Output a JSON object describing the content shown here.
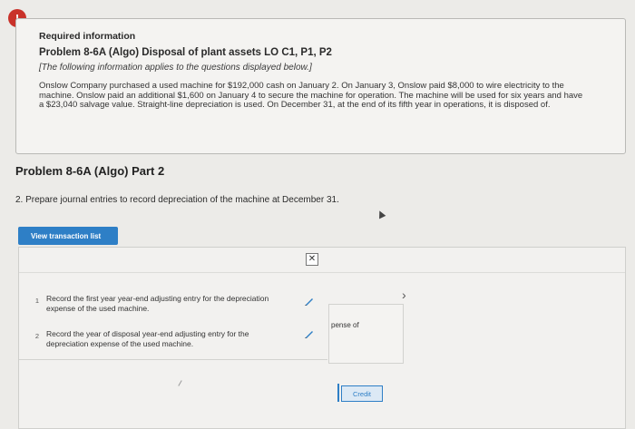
{
  "alert": {
    "symbol": "!"
  },
  "info": {
    "heading": "Required information",
    "title": "Problem 8-6A (Algo) Disposal of plant assets LO C1, P1, P2",
    "note": "[The following information applies to the questions displayed below.]",
    "body": "Onslow Company purchased a used machine for $192,000 cash on January 2. On January 3, Onslow paid $8,000 to wire electricity to the machine. Onslow paid an additional $1,600 on January 4 to secure the machine for operation. The machine will be used for six years and have a $23,040 salvage value. Straight-line depreciation is used. On December 31, at the end of its fifth year in operations, it is disposed of."
  },
  "part_title": "Problem 8-6A (Algo) Part 2",
  "question": "2. Prepare journal entries to record depreciation of the machine at December 31.",
  "view_button": "View transaction list",
  "transactions": [
    {
      "num": "1",
      "text": "Record the first year year-end adjusting entry for the depreciation expense of the used machine."
    },
    {
      "num": "2",
      "text": "Record the year of disposal year-end adjusting entry for the depreciation expense of the used machine."
    }
  ],
  "fragments": {
    "right_text": "pense of",
    "credit": "Credit",
    "close": "✕",
    "chevron": "›"
  },
  "colors": {
    "alert": "#c9322a",
    "accent": "#2e7fc6"
  }
}
